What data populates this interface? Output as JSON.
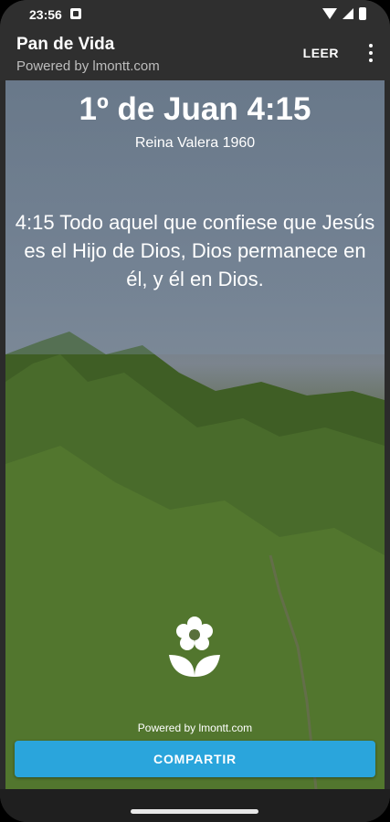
{
  "status_bar": {
    "time": "23:56"
  },
  "app_bar": {
    "title": "Pan de Vida",
    "subtitle": "Powered by lmontt.com",
    "read_label": "LEER"
  },
  "verse": {
    "reference": "1º de Juan 4:15",
    "version": "Reina Valera 1960",
    "text": "4:15 Todo aquel que confiese que Jesús es el Hijo de Dios, Dios permanece en él, y él en Dios."
  },
  "footer": {
    "powered": "Powered by lmontt.com",
    "share_label": "COMPARTIR"
  },
  "colors": {
    "accent": "#2aa5dc",
    "app_bar": "#2f2f2f"
  }
}
